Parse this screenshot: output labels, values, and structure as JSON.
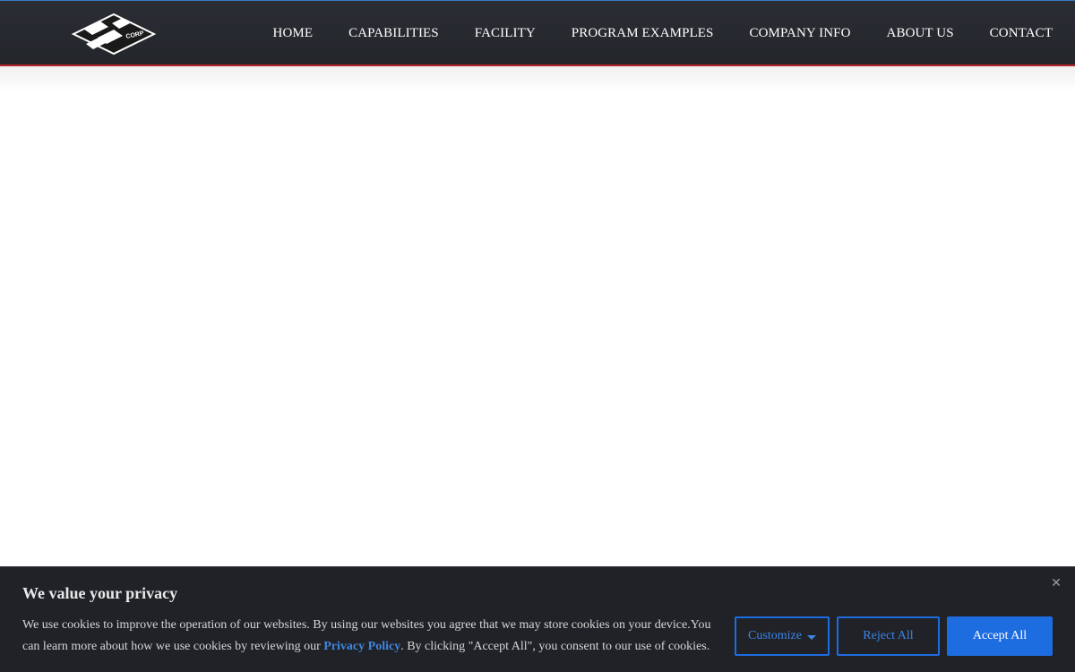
{
  "header": {
    "logo_icon": "mtd-corp-logo-icon",
    "logo_text": "CORP",
    "nav": [
      {
        "label": "HOME"
      },
      {
        "label": "CAPABILITIES"
      },
      {
        "label": "FACILITY"
      },
      {
        "label": "PROGRAM EXAMPLES"
      },
      {
        "label": "COMPANY INFO"
      },
      {
        "label": "ABOUT US"
      },
      {
        "label": "CONTACT"
      }
    ]
  },
  "cookie_banner": {
    "title": "We value your privacy",
    "text_before_link": "We use cookies to improve the operation of our websites. By using our websites you agree that we may store cookies on your device.You can learn more about how we use cookies by reviewing our ",
    "link_text": "Privacy Policy",
    "text_after_link": ". By clicking \"Accept All\", you consent to our use of cookies.",
    "customize_label": "Customize",
    "reject_label": "Reject All",
    "accept_label": "Accept All",
    "close_icon": "close-icon"
  },
  "colors": {
    "header_bg": "#2a2d33",
    "header_bottom_border": "#b8262b",
    "banner_bg": "#202227",
    "accent_blue": "#1d6ce0"
  }
}
